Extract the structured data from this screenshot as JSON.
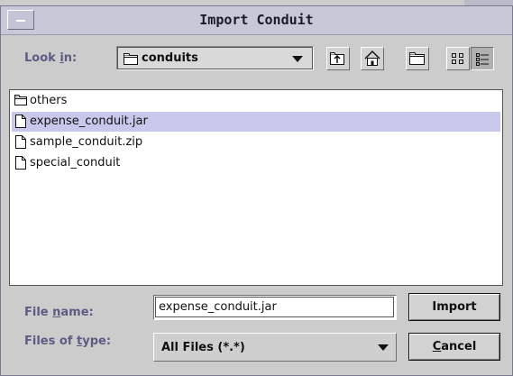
{
  "dialog": {
    "title": "Import Conduit",
    "look_in_label": "Look in:",
    "look_in_value": "conduits",
    "toolbar_icons": [
      "up-one-level-icon",
      "home-icon",
      "new-folder-icon",
      "list-view-icon",
      "details-view-icon"
    ],
    "files": [
      {
        "name": "others",
        "kind": "folder",
        "selected": false
      },
      {
        "name": "expense_conduit.jar",
        "kind": "file",
        "selected": true
      },
      {
        "name": "sample_conduit.zip",
        "kind": "file",
        "selected": false
      },
      {
        "name": "special_conduit",
        "kind": "file",
        "selected": false
      }
    ],
    "file_name_label": "File name:",
    "file_name_value": "expense_conduit.jar",
    "files_of_type_label": "Files of type:",
    "files_of_type_value": "All Files (*.*)",
    "import_button": "Import",
    "cancel_button": "Cancel"
  },
  "colors": {
    "title_bar": "#c8c8d8",
    "selection": "#c8c8ec",
    "label_text": "#5c5c84",
    "background": "#cccccc"
  }
}
